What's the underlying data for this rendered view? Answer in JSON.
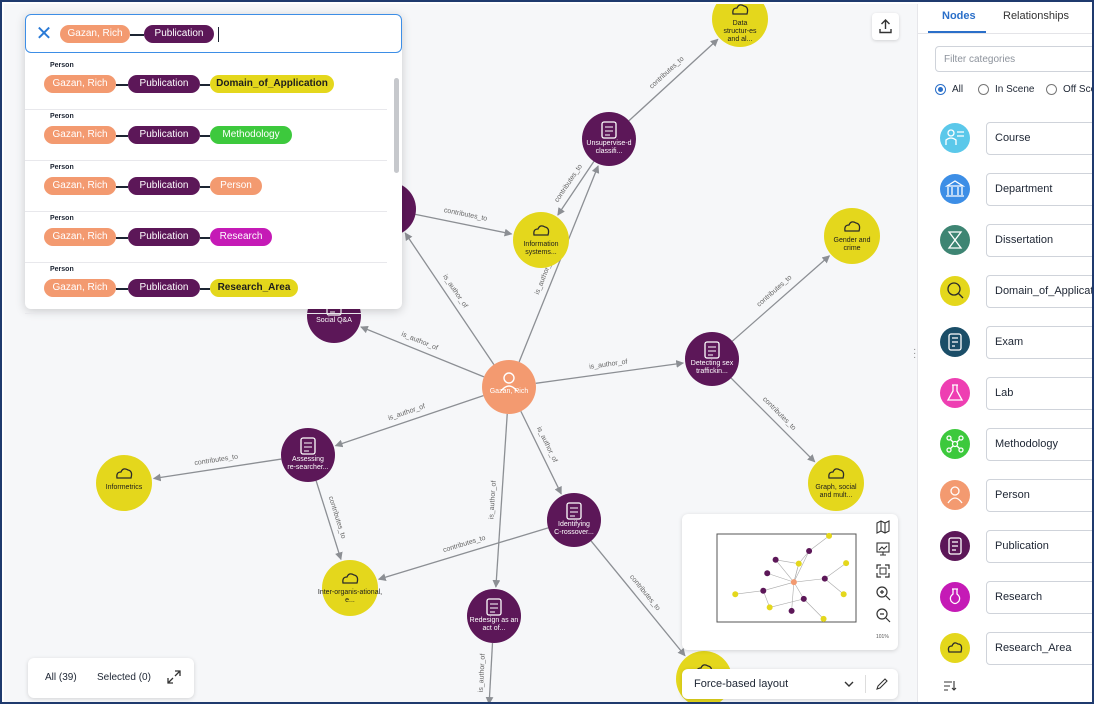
{
  "search": {
    "chips": [
      "Gazan, Rich",
      "Publication"
    ],
    "suggestions": [
      {
        "label": "Person",
        "chips": [
          "Gazan, Rich",
          "Publication",
          "Domain_of_Application"
        ]
      },
      {
        "label": "Person",
        "chips": [
          "Gazan, Rich",
          "Publication",
          "Methodology"
        ]
      },
      {
        "label": "Person",
        "chips": [
          "Gazan, Rich",
          "Publication",
          "Person"
        ]
      },
      {
        "label": "Person",
        "chips": [
          "Gazan, Rich",
          "Publication",
          "Research"
        ]
      },
      {
        "label": "Person",
        "chips": [
          "Gazan, Rich",
          "Publication",
          "Research_Area"
        ]
      }
    ]
  },
  "graph": {
    "nodes": [
      {
        "id": "rich",
        "label": "Gazan, Rich",
        "type": "person"
      },
      {
        "id": "data_struct",
        "label": "Data structur-es and al...",
        "type": "area"
      },
      {
        "id": "unsup",
        "label": "Unsupervise-d classifi...",
        "type": "pub"
      },
      {
        "id": "info_sys",
        "label": "Information systems...",
        "type": "area"
      },
      {
        "id": "gender",
        "label": "Gender and crime",
        "type": "area"
      },
      {
        "id": "social_qa",
        "label": "Social Q&A",
        "type": "pub"
      },
      {
        "id": "pub_hidden",
        "label": "",
        "type": "pub"
      },
      {
        "id": "detect",
        "label": "Detecting sex traffickin...",
        "type": "pub"
      },
      {
        "id": "assess",
        "label": "Assessing re-searcher...",
        "type": "pub"
      },
      {
        "id": "informetrics",
        "label": "Informetrics",
        "type": "area"
      },
      {
        "id": "graph_social",
        "label": "Graph, social and mult...",
        "type": "area"
      },
      {
        "id": "identify",
        "label": "Identifying C-rossover...",
        "type": "pub"
      },
      {
        "id": "inter_org",
        "label": "Inter-organis-ational, e...",
        "type": "area"
      },
      {
        "id": "redesign",
        "label": "Redesign as an act of...",
        "type": "pub"
      },
      {
        "id": "bottom_area",
        "label": "",
        "type": "area"
      }
    ],
    "edges": [
      {
        "label": "contributes_to"
      },
      {
        "label": "contributes_to"
      },
      {
        "label": "contributes_to"
      },
      {
        "label": "is_author_of"
      },
      {
        "label": "is_author_of"
      },
      {
        "label": "is_author_of"
      },
      {
        "label": "is_author_of"
      },
      {
        "label": "is_author_of"
      },
      {
        "label": "is_author_of"
      },
      {
        "label": "is_author_of"
      },
      {
        "label": "contributes_to"
      },
      {
        "label": "contributes_to"
      },
      {
        "label": "contributes_to"
      },
      {
        "label": "contributes_to"
      },
      {
        "label": "contributes_to"
      },
      {
        "label": "contributes_to"
      },
      {
        "label": "contributes_to"
      },
      {
        "label": "is_author_of"
      },
      {
        "label": "contributes_to"
      }
    ]
  },
  "counters": {
    "all": "All (39)",
    "selected": "Selected (0)"
  },
  "minimap": {
    "zoom": "101%"
  },
  "layout": {
    "selected": "Force-based layout"
  },
  "panel": {
    "tabs": [
      "Nodes",
      "Relationships"
    ],
    "filter_placeholder": "Filter categories",
    "scope_options": [
      "All",
      "In Scene",
      "Off Scene"
    ],
    "scope_selected": "All",
    "categories": [
      {
        "name": "Course",
        "color": "#5bc8ea",
        "icon": "course-icon"
      },
      {
        "name": "Department",
        "color": "#3d8ee6",
        "icon": "bank-icon"
      },
      {
        "name": "Dissertation",
        "color": "#3e8573",
        "icon": "hourglass-icon"
      },
      {
        "name": "Domain_of_Application",
        "color": "#e4d71c",
        "icon": "magnifier-icon"
      },
      {
        "name": "Exam",
        "color": "#1b4e68",
        "icon": "exam-icon"
      },
      {
        "name": "Lab",
        "color": "#ee3fb2",
        "icon": "flask-icon"
      },
      {
        "name": "Methodology",
        "color": "#3dc93d",
        "icon": "network-icon"
      },
      {
        "name": "Person",
        "color": "#f39a70",
        "icon": "person-icon"
      },
      {
        "name": "Publication",
        "color": "#5c1758",
        "icon": "document-icon"
      },
      {
        "name": "Research",
        "color": "#c51ab6",
        "icon": "research-icon"
      },
      {
        "name": "Research_Area",
        "color": "#e4d71c",
        "icon": "cloud-icon"
      }
    ]
  },
  "colors": {
    "person": "#f39a70",
    "pub": "#5c1758",
    "area": "#e4d71c",
    "accent": "#2a6fc9"
  }
}
